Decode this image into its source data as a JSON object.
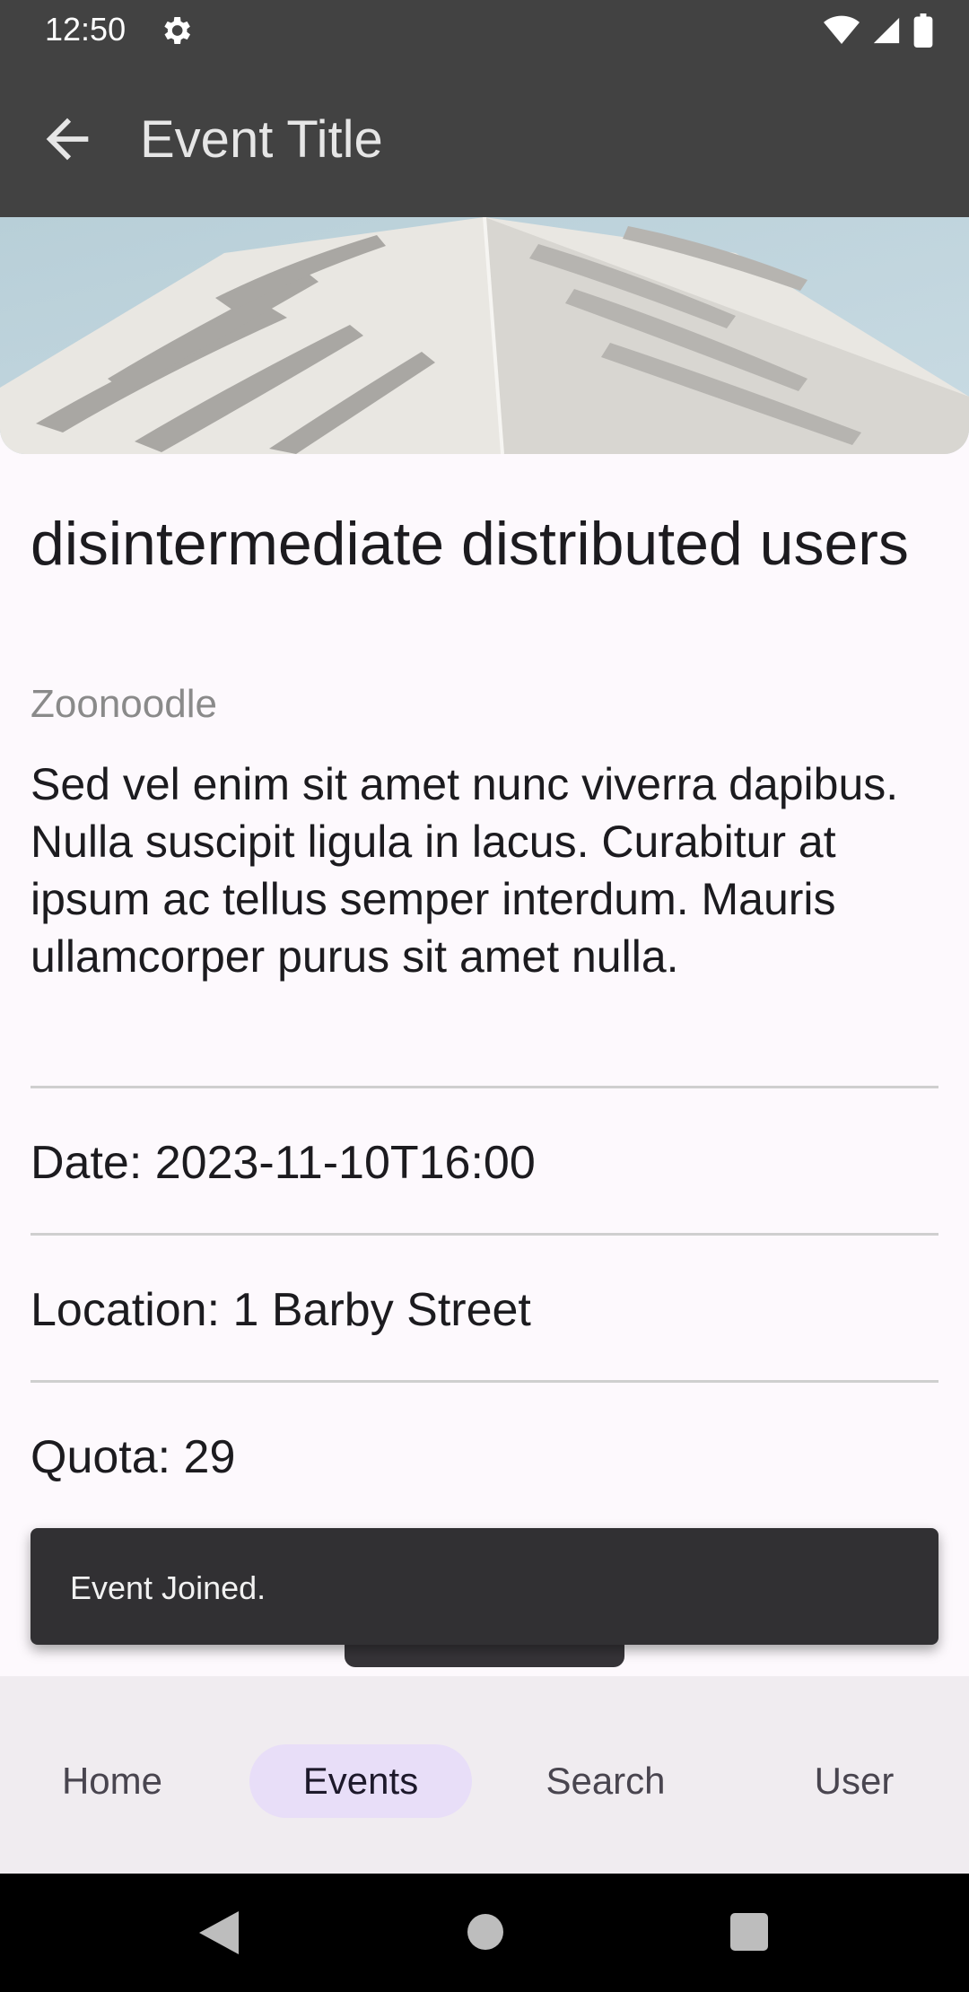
{
  "status_bar": {
    "time": "12:50",
    "icons": [
      "gear-icon",
      "wifi-icon",
      "signal-icon",
      "battery-icon"
    ]
  },
  "app_bar": {
    "title": "Event Title",
    "back_icon": "arrow-back-icon"
  },
  "event": {
    "name": "disintermediate distributed users",
    "organizer": "Zoonoodle",
    "description": "Sed vel enim sit amet nunc viverra dapibus. Nulla suscipit ligula in lacus. Curabitur at ipsum ac tellus semper interdum. Mauris ullamcorper purus sit amet nulla.",
    "date_label": "Date: 2023-11-10T16:00",
    "location_label": "Location: 1 Barby Street",
    "quota_label": "Quota: 29"
  },
  "snackbar": {
    "message": "Event Joined."
  },
  "bottom_nav": {
    "items": [
      {
        "label": "Home",
        "selected": false
      },
      {
        "label": "Events",
        "selected": true
      },
      {
        "label": "Search",
        "selected": false
      },
      {
        "label": "User",
        "selected": false
      }
    ]
  },
  "colors": {
    "app_bar": "#424242",
    "background": "#fdf9fd",
    "snackbar": "#313033",
    "nav_background": "#f0ecf0",
    "nav_pill": "#e8def8"
  }
}
